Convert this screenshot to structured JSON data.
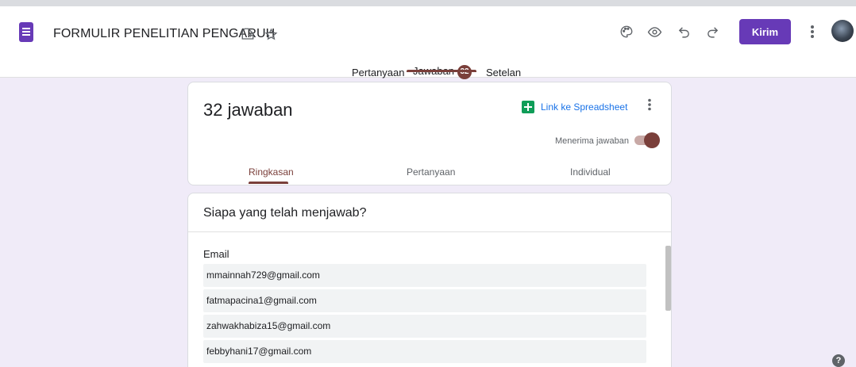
{
  "header": {
    "title": "FORMULIR PENELITIAN PENGARUH",
    "send_label": "Kirim",
    "icons": [
      "forms-app-icon",
      "move-to-folder-icon",
      "star-icon",
      "palette-icon",
      "preview-eye-icon",
      "undo-icon",
      "redo-icon",
      "more-vert-icon",
      "avatar"
    ]
  },
  "tabs": {
    "questions": "Pertanyaan",
    "responses": "Jawaban",
    "responses_count": "32",
    "settings": "Setelan"
  },
  "summary_card": {
    "count_text": "32 jawaban",
    "spreadsheet_link": "Link ke Spreadsheet",
    "accepting_label": "Menerima jawaban",
    "accepting": true,
    "subtabs": [
      "Ringkasan",
      "Pertanyaan",
      "Individual"
    ],
    "active_subtab": "Ringkasan"
  },
  "respondents_card": {
    "title": "Siapa yang telah menjawab?",
    "column_label": "Email",
    "emails": [
      "mmainnah729@gmail.com",
      "fatmapacina1@gmail.com",
      "zahwakhabiza15@gmail.com",
      "febbyhani17@gmail.com"
    ]
  },
  "colors": {
    "brand": "#673ab7",
    "accent": "#7a3f3a",
    "background": "#f0ebf8",
    "link": "#1a73e8",
    "sheets": "#0f9d58"
  }
}
